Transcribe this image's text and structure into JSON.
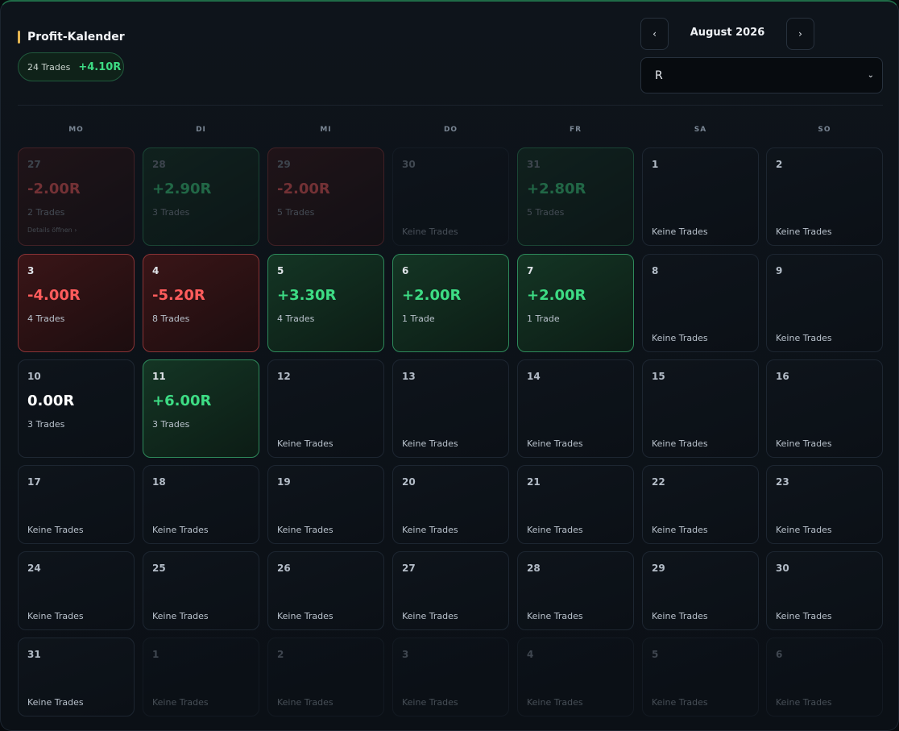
{
  "header": {
    "title": "Profit-Kalender",
    "trades_label": "24 Trades",
    "total_r": "+4.10R",
    "prev_label": "‹",
    "next_label": "›",
    "month": "August 2026",
    "unit_select": {
      "value": "R",
      "caret": "⌄"
    }
  },
  "weekdays": [
    "MO",
    "DI",
    "MI",
    "DO",
    "FR",
    "SA",
    "SO"
  ],
  "empty_text": "Keine Trades",
  "details_hint": "Details öffnen ›",
  "colors": {
    "accent_gold": "#e3b450",
    "positive": "#3ddc84",
    "negative": "#ff5c5c"
  },
  "weeks": [
    [
      {
        "day": "27",
        "value": "-2.00R",
        "trades": "2 Trades",
        "status": "neg",
        "outside": true,
        "hint": true
      },
      {
        "day": "28",
        "value": "+2.90R",
        "trades": "3 Trades",
        "status": "pos",
        "outside": true
      },
      {
        "day": "29",
        "value": "-2.00R",
        "trades": "5 Trades",
        "status": "neg",
        "outside": true
      },
      {
        "day": "30",
        "status": "empty",
        "outside": true
      },
      {
        "day": "31",
        "value": "+2.80R",
        "trades": "5 Trades",
        "status": "pos",
        "outside": true
      },
      {
        "day": "1",
        "status": "empty"
      },
      {
        "day": "2",
        "status": "empty"
      }
    ],
    [
      {
        "day": "3",
        "value": "-4.00R",
        "trades": "4 Trades",
        "status": "neg"
      },
      {
        "day": "4",
        "value": "-5.20R",
        "trades": "8 Trades",
        "status": "neg"
      },
      {
        "day": "5",
        "value": "+3.30R",
        "trades": "4 Trades",
        "status": "pos"
      },
      {
        "day": "6",
        "value": "+2.00R",
        "trades": "1 Trade",
        "status": "pos"
      },
      {
        "day": "7",
        "value": "+2.00R",
        "trades": "1 Trade",
        "status": "pos"
      },
      {
        "day": "8",
        "status": "empty"
      },
      {
        "day": "9",
        "status": "empty"
      }
    ],
    [
      {
        "day": "10",
        "value": "0.00R",
        "trades": "3 Trades",
        "status": "zero"
      },
      {
        "day": "11",
        "value": "+6.00R",
        "trades": "3 Trades",
        "status": "pos"
      },
      {
        "day": "12",
        "status": "empty"
      },
      {
        "day": "13",
        "status": "empty"
      },
      {
        "day": "14",
        "status": "empty"
      },
      {
        "day": "15",
        "status": "empty"
      },
      {
        "day": "16",
        "status": "empty"
      }
    ],
    [
      {
        "day": "17",
        "status": "empty"
      },
      {
        "day": "18",
        "status": "empty"
      },
      {
        "day": "19",
        "status": "empty"
      },
      {
        "day": "20",
        "status": "empty"
      },
      {
        "day": "21",
        "status": "empty"
      },
      {
        "day": "22",
        "status": "empty"
      },
      {
        "day": "23",
        "status": "empty"
      }
    ],
    [
      {
        "day": "24",
        "status": "empty"
      },
      {
        "day": "25",
        "status": "empty"
      },
      {
        "day": "26",
        "status": "empty"
      },
      {
        "day": "27",
        "status": "empty"
      },
      {
        "day": "28",
        "status": "empty"
      },
      {
        "day": "29",
        "status": "empty"
      },
      {
        "day": "30",
        "status": "empty"
      }
    ],
    [
      {
        "day": "31",
        "status": "empty"
      },
      {
        "day": "1",
        "status": "empty",
        "outside": true
      },
      {
        "day": "2",
        "status": "empty",
        "outside": true
      },
      {
        "day": "3",
        "status": "empty",
        "outside": true
      },
      {
        "day": "4",
        "status": "empty",
        "outside": true
      },
      {
        "day": "5",
        "status": "empty",
        "outside": true
      },
      {
        "day": "6",
        "status": "empty",
        "outside": true
      }
    ]
  ]
}
